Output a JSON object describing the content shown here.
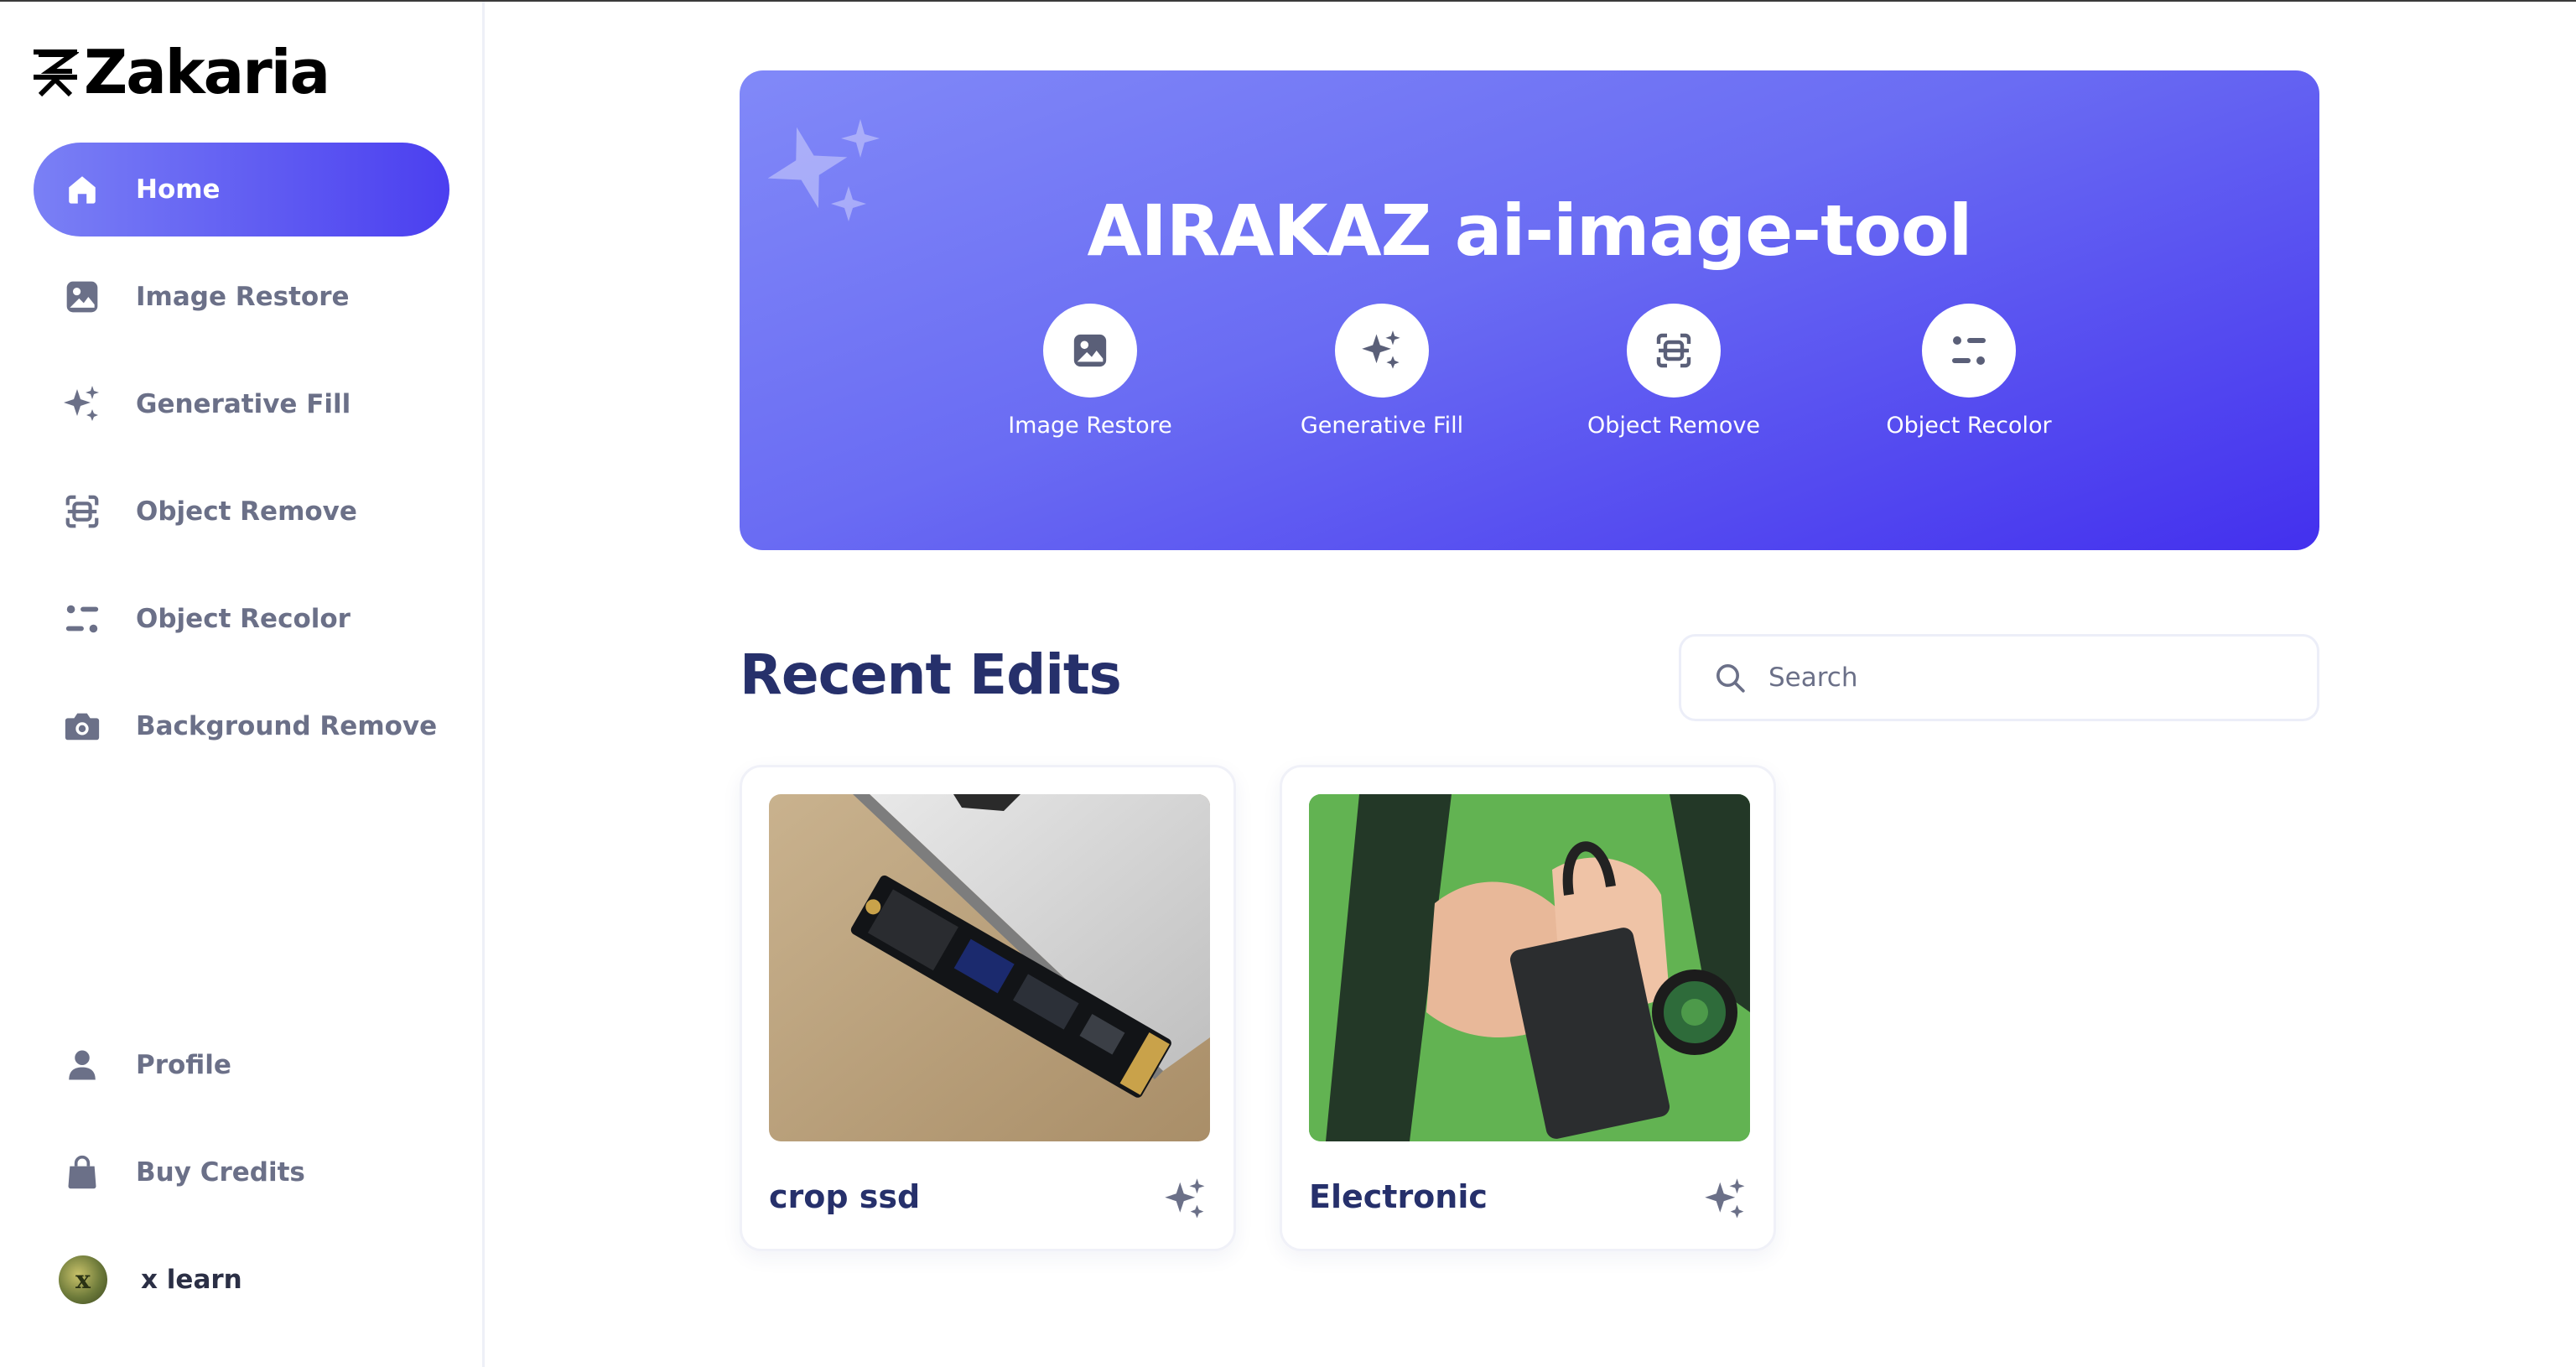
{
  "brand": {
    "name": "Zakaria"
  },
  "sidebar": {
    "items": [
      {
        "label": "Home",
        "icon": "home-icon",
        "active": true
      },
      {
        "label": "Image Restore",
        "icon": "image-icon"
      },
      {
        "label": "Generative Fill",
        "icon": "sparkles-icon"
      },
      {
        "label": "Object Remove",
        "icon": "scan-icon"
      },
      {
        "label": "Object Recolor",
        "icon": "filter-icon"
      },
      {
        "label": "Background Remove",
        "icon": "camera-icon"
      }
    ],
    "bottom": [
      {
        "label": "Profile",
        "icon": "user-icon"
      },
      {
        "label": "Buy Credits",
        "icon": "shopping-bag-icon"
      }
    ],
    "user": {
      "name": "x learn"
    }
  },
  "hero": {
    "title": "AIRAKAZ ai-image-tool",
    "tools": [
      {
        "label": "Image Restore",
        "icon": "image-icon"
      },
      {
        "label": "Generative Fill",
        "icon": "sparkles-icon"
      },
      {
        "label": "Object Remove",
        "icon": "scan-icon"
      },
      {
        "label": "Object Recolor",
        "icon": "filter-icon"
      }
    ]
  },
  "recent": {
    "title": "Recent Edits",
    "search_placeholder": "Search",
    "cards": [
      {
        "title": "crop ssd"
      },
      {
        "title": "Electronic"
      }
    ]
  },
  "colors": {
    "accent_start": "#7a80f5",
    "accent_end": "#4b3ff0",
    "heading": "#26306b",
    "muted": "#6b7088"
  }
}
